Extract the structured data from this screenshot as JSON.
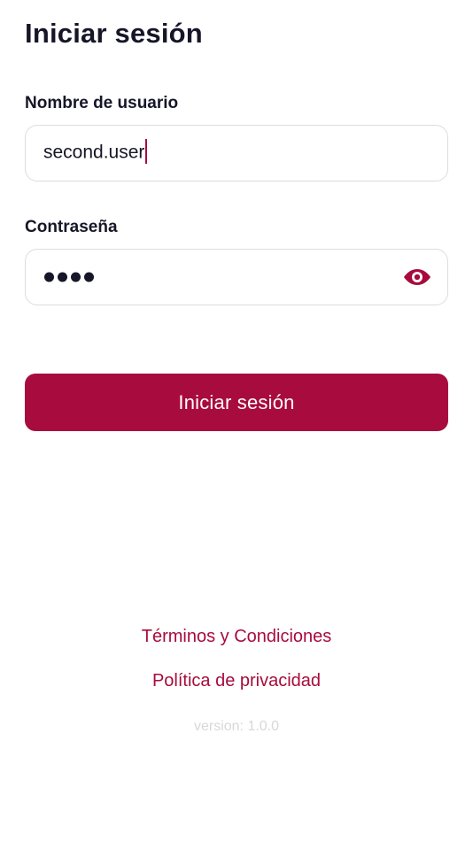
{
  "page": {
    "title": "Iniciar sesión"
  },
  "form": {
    "username_label": "Nombre de usuario",
    "username_value": "second.user",
    "password_label": "Contraseña",
    "password_masked_length": 4,
    "submit_label": "Iniciar sesión"
  },
  "links": {
    "terms": "Términos y Condiciones",
    "privacy": "Política de privacidad"
  },
  "footer": {
    "version": "version: 1.0.0"
  },
  "icons": {
    "password_toggle": "eye-icon"
  },
  "colors": {
    "accent": "#a80b3d",
    "text": "#161628",
    "border": "#dcdce2",
    "muted": "#d8d8dc"
  }
}
